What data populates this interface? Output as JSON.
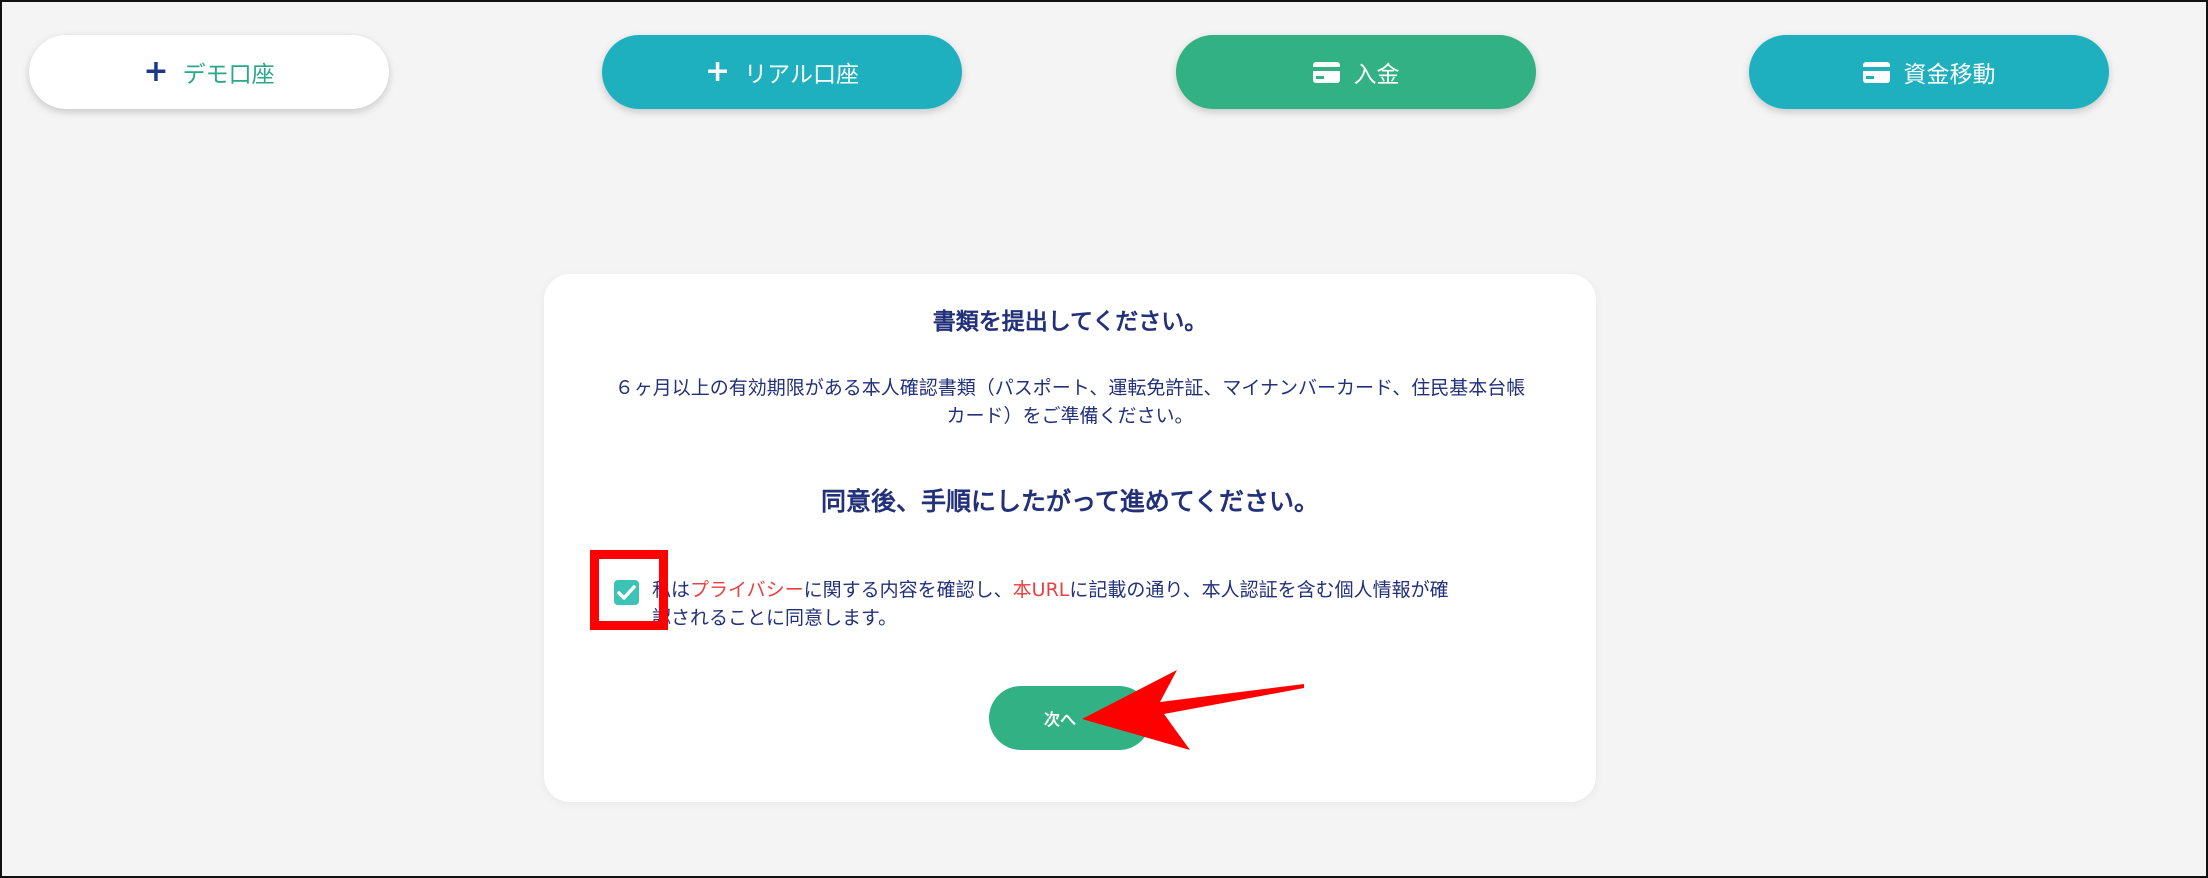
{
  "topbar": {
    "demo_label": "デモ口座",
    "real_label": "リアル口座",
    "deposit_label": "入金",
    "transfer_label": "資金移動"
  },
  "modal": {
    "title": "書類を提出してください。",
    "description": "６ヶ月以上の有効期限がある本人確認書類（パスポート、運転免許証、マイナンバーカード、住民基本台帳カード）をご準備ください。",
    "heading": "同意後、手順にしたがって進めてください。",
    "consent_prefix": "私は",
    "consent_link1": "プライバシー",
    "consent_middle": "に関する内容を確認し、",
    "consent_link2": "本URL",
    "consent_suffix": "に記載の通り、本人認証を含む個人情報が確認されることに同意します。",
    "consent_checked": true,
    "next_label": "次へ"
  },
  "colors": {
    "accent_teal": "#1eb0bf",
    "accent_green": "#32b184",
    "text_navy": "#23307a",
    "link_red": "#e84040",
    "annotation_red": "#ff0000"
  }
}
